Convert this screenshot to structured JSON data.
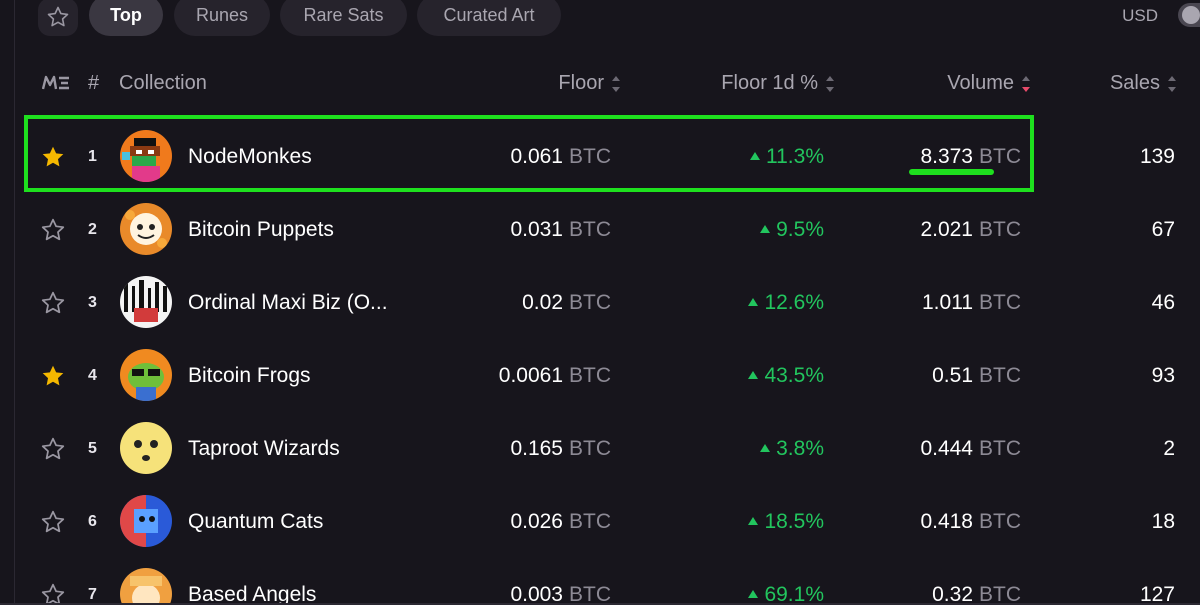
{
  "tabs": [
    {
      "label": "Top",
      "active": true
    },
    {
      "label": "Runes",
      "active": false
    },
    {
      "label": "Rare Sats",
      "active": false
    },
    {
      "label": "Curated Art",
      "active": false
    }
  ],
  "currency": "USD",
  "header": {
    "rank": "#",
    "collection": "Collection",
    "floor": "Floor",
    "floor_change": "Floor 1d %",
    "volume": "Volume",
    "sales": "Sales"
  },
  "unit": "BTC",
  "colors": {
    "positive": "#22c55e",
    "highlight": "#1ee01e",
    "star_favorite": "#f5b800"
  },
  "rows": [
    {
      "rank": "1",
      "name": "NodeMonkes",
      "floor": "0.061",
      "change": "11.3%",
      "volume": "8.373",
      "sales": "139",
      "favorited": true
    },
    {
      "rank": "2",
      "name": "Bitcoin Puppets",
      "floor": "0.031",
      "change": "9.5%",
      "volume": "2.021",
      "sales": "67",
      "favorited": false
    },
    {
      "rank": "3",
      "name": "Ordinal Maxi Biz (O...",
      "floor": "0.02",
      "change": "12.6%",
      "volume": "1.011",
      "sales": "46",
      "favorited": false
    },
    {
      "rank": "4",
      "name": "Bitcoin Frogs",
      "floor": "0.0061",
      "change": "43.5%",
      "volume": "0.51",
      "sales": "93",
      "favorited": true
    },
    {
      "rank": "5",
      "name": "Taproot Wizards",
      "floor": "0.165",
      "change": "3.8%",
      "volume": "0.444",
      "sales": "2",
      "favorited": false
    },
    {
      "rank": "6",
      "name": "Quantum Cats",
      "floor": "0.026",
      "change": "18.5%",
      "volume": "0.418",
      "sales": "18",
      "favorited": false
    },
    {
      "rank": "7",
      "name": "Based Angels",
      "floor": "0.003",
      "change": "69.1%",
      "volume": "0.32",
      "sales": "127",
      "favorited": false
    }
  ]
}
